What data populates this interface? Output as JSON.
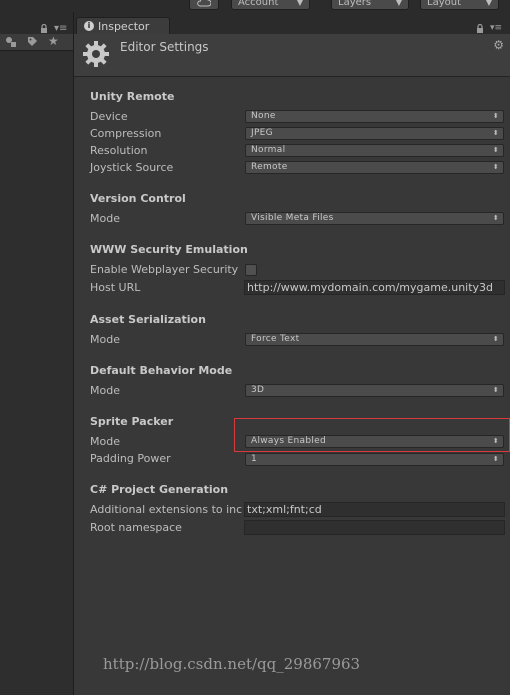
{
  "toolbar": {
    "account_label": "Account",
    "layers_label": "Layers",
    "layout_label": "Layout",
    "cloud_icon": "cloud-icon"
  },
  "inspector": {
    "tab_label": "Inspector",
    "title": "Editor Settings"
  },
  "sections": {
    "unity_remote": {
      "title": "Unity Remote",
      "device_label": "Device",
      "device_value": "None",
      "compression_label": "Compression",
      "compression_value": "JPEG",
      "resolution_label": "Resolution",
      "resolution_value": "Normal",
      "joystick_label": "Joystick Source",
      "joystick_value": "Remote"
    },
    "version_control": {
      "title": "Version Control",
      "mode_label": "Mode",
      "mode_value": "Visible Meta Files"
    },
    "www_security": {
      "title": "WWW Security Emulation",
      "enable_label": "Enable Webplayer Security",
      "enable_checked": false,
      "host_label": "Host URL",
      "host_value": "http://www.mydomain.com/mygame.unity3d"
    },
    "asset_serialization": {
      "title": "Asset Serialization",
      "mode_label": "Mode",
      "mode_value": "Force Text"
    },
    "default_behavior": {
      "title": "Default Behavior Mode",
      "mode_label": "Mode",
      "mode_value": "3D"
    },
    "sprite_packer": {
      "title": "Sprite Packer",
      "mode_label": "Mode",
      "mode_value": "Always Enabled",
      "padding_label": "Padding Power",
      "padding_value": "1"
    },
    "csharp_project": {
      "title": "C# Project Generation",
      "extensions_label": "Additional extensions to inc",
      "extensions_value": "txt;xml;fnt;cd",
      "namespace_label": "Root namespace",
      "namespace_value": ""
    }
  },
  "watermark": "http://blog.csdn.net/qq_29867963",
  "colors": {
    "highlight": "#d8393b",
    "background": "#383838"
  }
}
